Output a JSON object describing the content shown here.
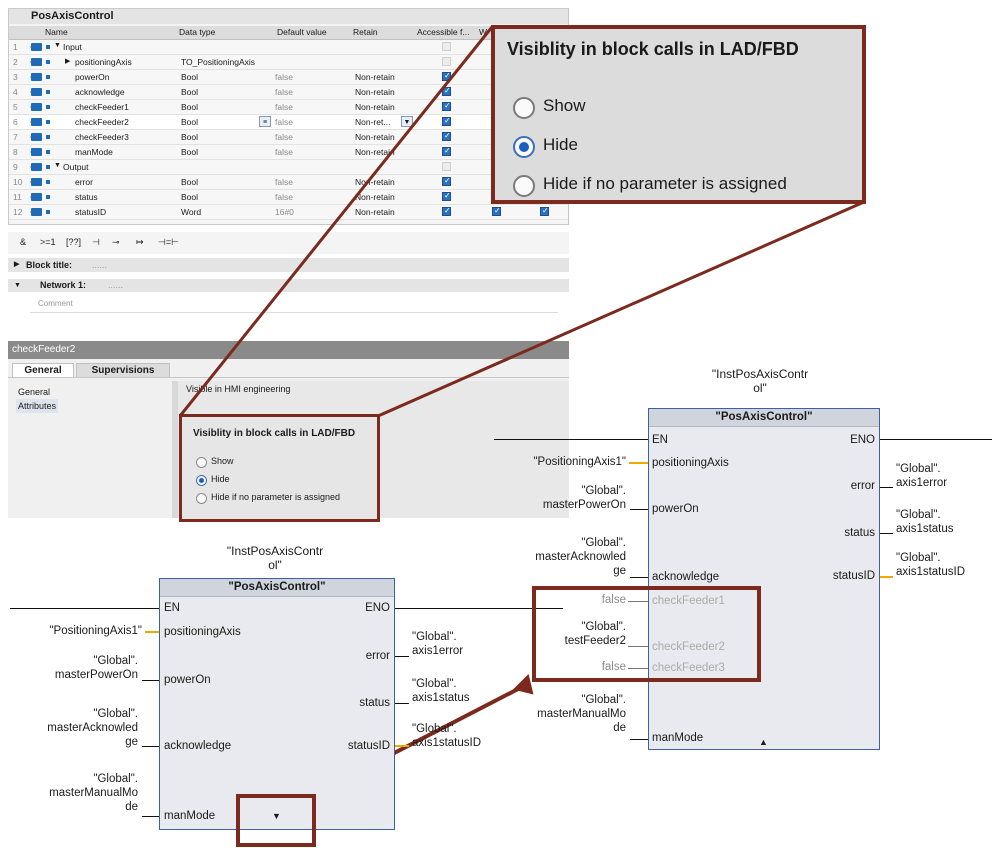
{
  "interface_table": {
    "title": "PosAxisControl",
    "headers": [
      "Name",
      "Data type",
      "Default value",
      "Retain",
      "Accessible f...",
      "W"
    ],
    "rows": [
      {
        "n": "1",
        "name": "Input",
        "type": "",
        "default": "",
        "retain": "",
        "section": true
      },
      {
        "n": "2",
        "name": "positioningAxis",
        "type": "TO_PositioningAxis",
        "default": "",
        "retain": ""
      },
      {
        "n": "3",
        "name": "powerOn",
        "type": "Bool",
        "default": "false",
        "retain": "Non-retain"
      },
      {
        "n": "4",
        "name": "acknowledge",
        "type": "Bool",
        "default": "false",
        "retain": "Non-retain"
      },
      {
        "n": "5",
        "name": "checkFeeder1",
        "type": "Bool",
        "default": "false",
        "retain": "Non-retain"
      },
      {
        "n": "6",
        "name": "checkFeeder2",
        "type": "Bool",
        "default": "false",
        "retain": "Non-ret..."
      },
      {
        "n": "7",
        "name": "checkFeeder3",
        "type": "Bool",
        "default": "false",
        "retain": "Non-retain"
      },
      {
        "n": "8",
        "name": "manMode",
        "type": "Bool",
        "default": "false",
        "retain": "Non-retain"
      },
      {
        "n": "9",
        "name": "Output",
        "type": "",
        "default": "",
        "retain": "",
        "section": true
      },
      {
        "n": "10",
        "name": "error",
        "type": "Bool",
        "default": "false",
        "retain": "Non-retain"
      },
      {
        "n": "11",
        "name": "status",
        "type": "Bool",
        "default": "false",
        "retain": "Non-retain"
      },
      {
        "n": "12",
        "name": "statusID",
        "type": "Word",
        "default": "16#0",
        "retain": "Non-retain"
      }
    ]
  },
  "toolbar": {
    "and": "&",
    "ge": ">=1",
    "box": "[??]",
    "contact": "⊣",
    "neg": "⊸",
    "assign": "↦",
    "coil": "⊣=⊢"
  },
  "block_title": "Block title:",
  "block_title_dots": "......",
  "network": "Network 1:",
  "network_dots": "......",
  "comment_placeholder": "Comment",
  "properties": {
    "object": "checkFeeder2",
    "tabs": [
      "General",
      "Supervisions"
    ],
    "nav": [
      "General",
      "Attributes"
    ],
    "hmi_option": "Visible in HMI engineering"
  },
  "visibility": {
    "heading": "Visiblity in block calls in LAD/FBD",
    "options": [
      "Show",
      "Hide",
      "Hide if no parameter is assigned"
    ],
    "selected": "Hide"
  },
  "fbd_left": {
    "instance": "\"InstPosAxisContr ol\"",
    "instance_l1": "\"InstPosAxisContr",
    "instance_l2": "ol\"",
    "block": "\"PosAxisControl\"",
    "en": "EN",
    "eno": "ENO",
    "inputs": [
      "positioningAxis",
      "powerOn",
      "acknowledge",
      "manMode"
    ],
    "outputs": [
      "error",
      "status",
      "statusID"
    ],
    "in_params": {
      "positioningAxis": "\"PositioningAxis1\"",
      "powerOn_l1": "\"Global\".",
      "powerOn_l2": "masterPowerOn",
      "ack_l1": "\"Global\".",
      "ack_l2": "masterAcknowled",
      "ack_l3": "ge",
      "man_l1": "\"Global\".",
      "man_l2": "masterManualMo",
      "man_l3": "de"
    },
    "out_params": {
      "error_l1": "\"Global\".",
      "error_l2": "axis1error",
      "status_l1": "\"Global\".",
      "status_l2": "axis1status",
      "statusID_l1": "\"Global\".",
      "statusID_l2": "axis1statusID"
    },
    "expander": "▼"
  },
  "fbd_right": {
    "instance_l1": "\"InstPosAxisContr",
    "instance_l2": "ol\"",
    "block": "\"PosAxisControl\"",
    "en": "EN",
    "eno": "ENO",
    "inputs": [
      "positioningAxis",
      "powerOn",
      "acknowledge",
      "checkFeeder1",
      "checkFeeder2",
      "checkFeeder3",
      "manMode"
    ],
    "outputs": [
      "error",
      "status",
      "statusID"
    ],
    "in_params": {
      "positioningAxis": "\"PositioningAxis1\"",
      "powerOn_l1": "\"Global\".",
      "powerOn_l2": "masterPowerOn",
      "ack_l1": "\"Global\".",
      "ack_l2": "masterAcknowled",
      "ack_l3": "ge",
      "cf1": "false",
      "cf2_l1": "\"Global\".",
      "cf2_l2": "testFeeder2",
      "cf3": "false",
      "man_l1": "\"Global\".",
      "man_l2": "masterManualMo",
      "man_l3": "de"
    },
    "out_params": {
      "error_l1": "\"Global\".",
      "error_l2": "axis1error",
      "status_l1": "\"Global\".",
      "status_l2": "axis1status",
      "statusID_l1": "\"Global\".",
      "statusID_l2": "axis1statusID"
    },
    "expander": "▲"
  },
  "colors": {
    "highlight_border": "#7b2a1d",
    "block_border": "#3e5fa3",
    "wire_yellow": "#f0a800"
  }
}
